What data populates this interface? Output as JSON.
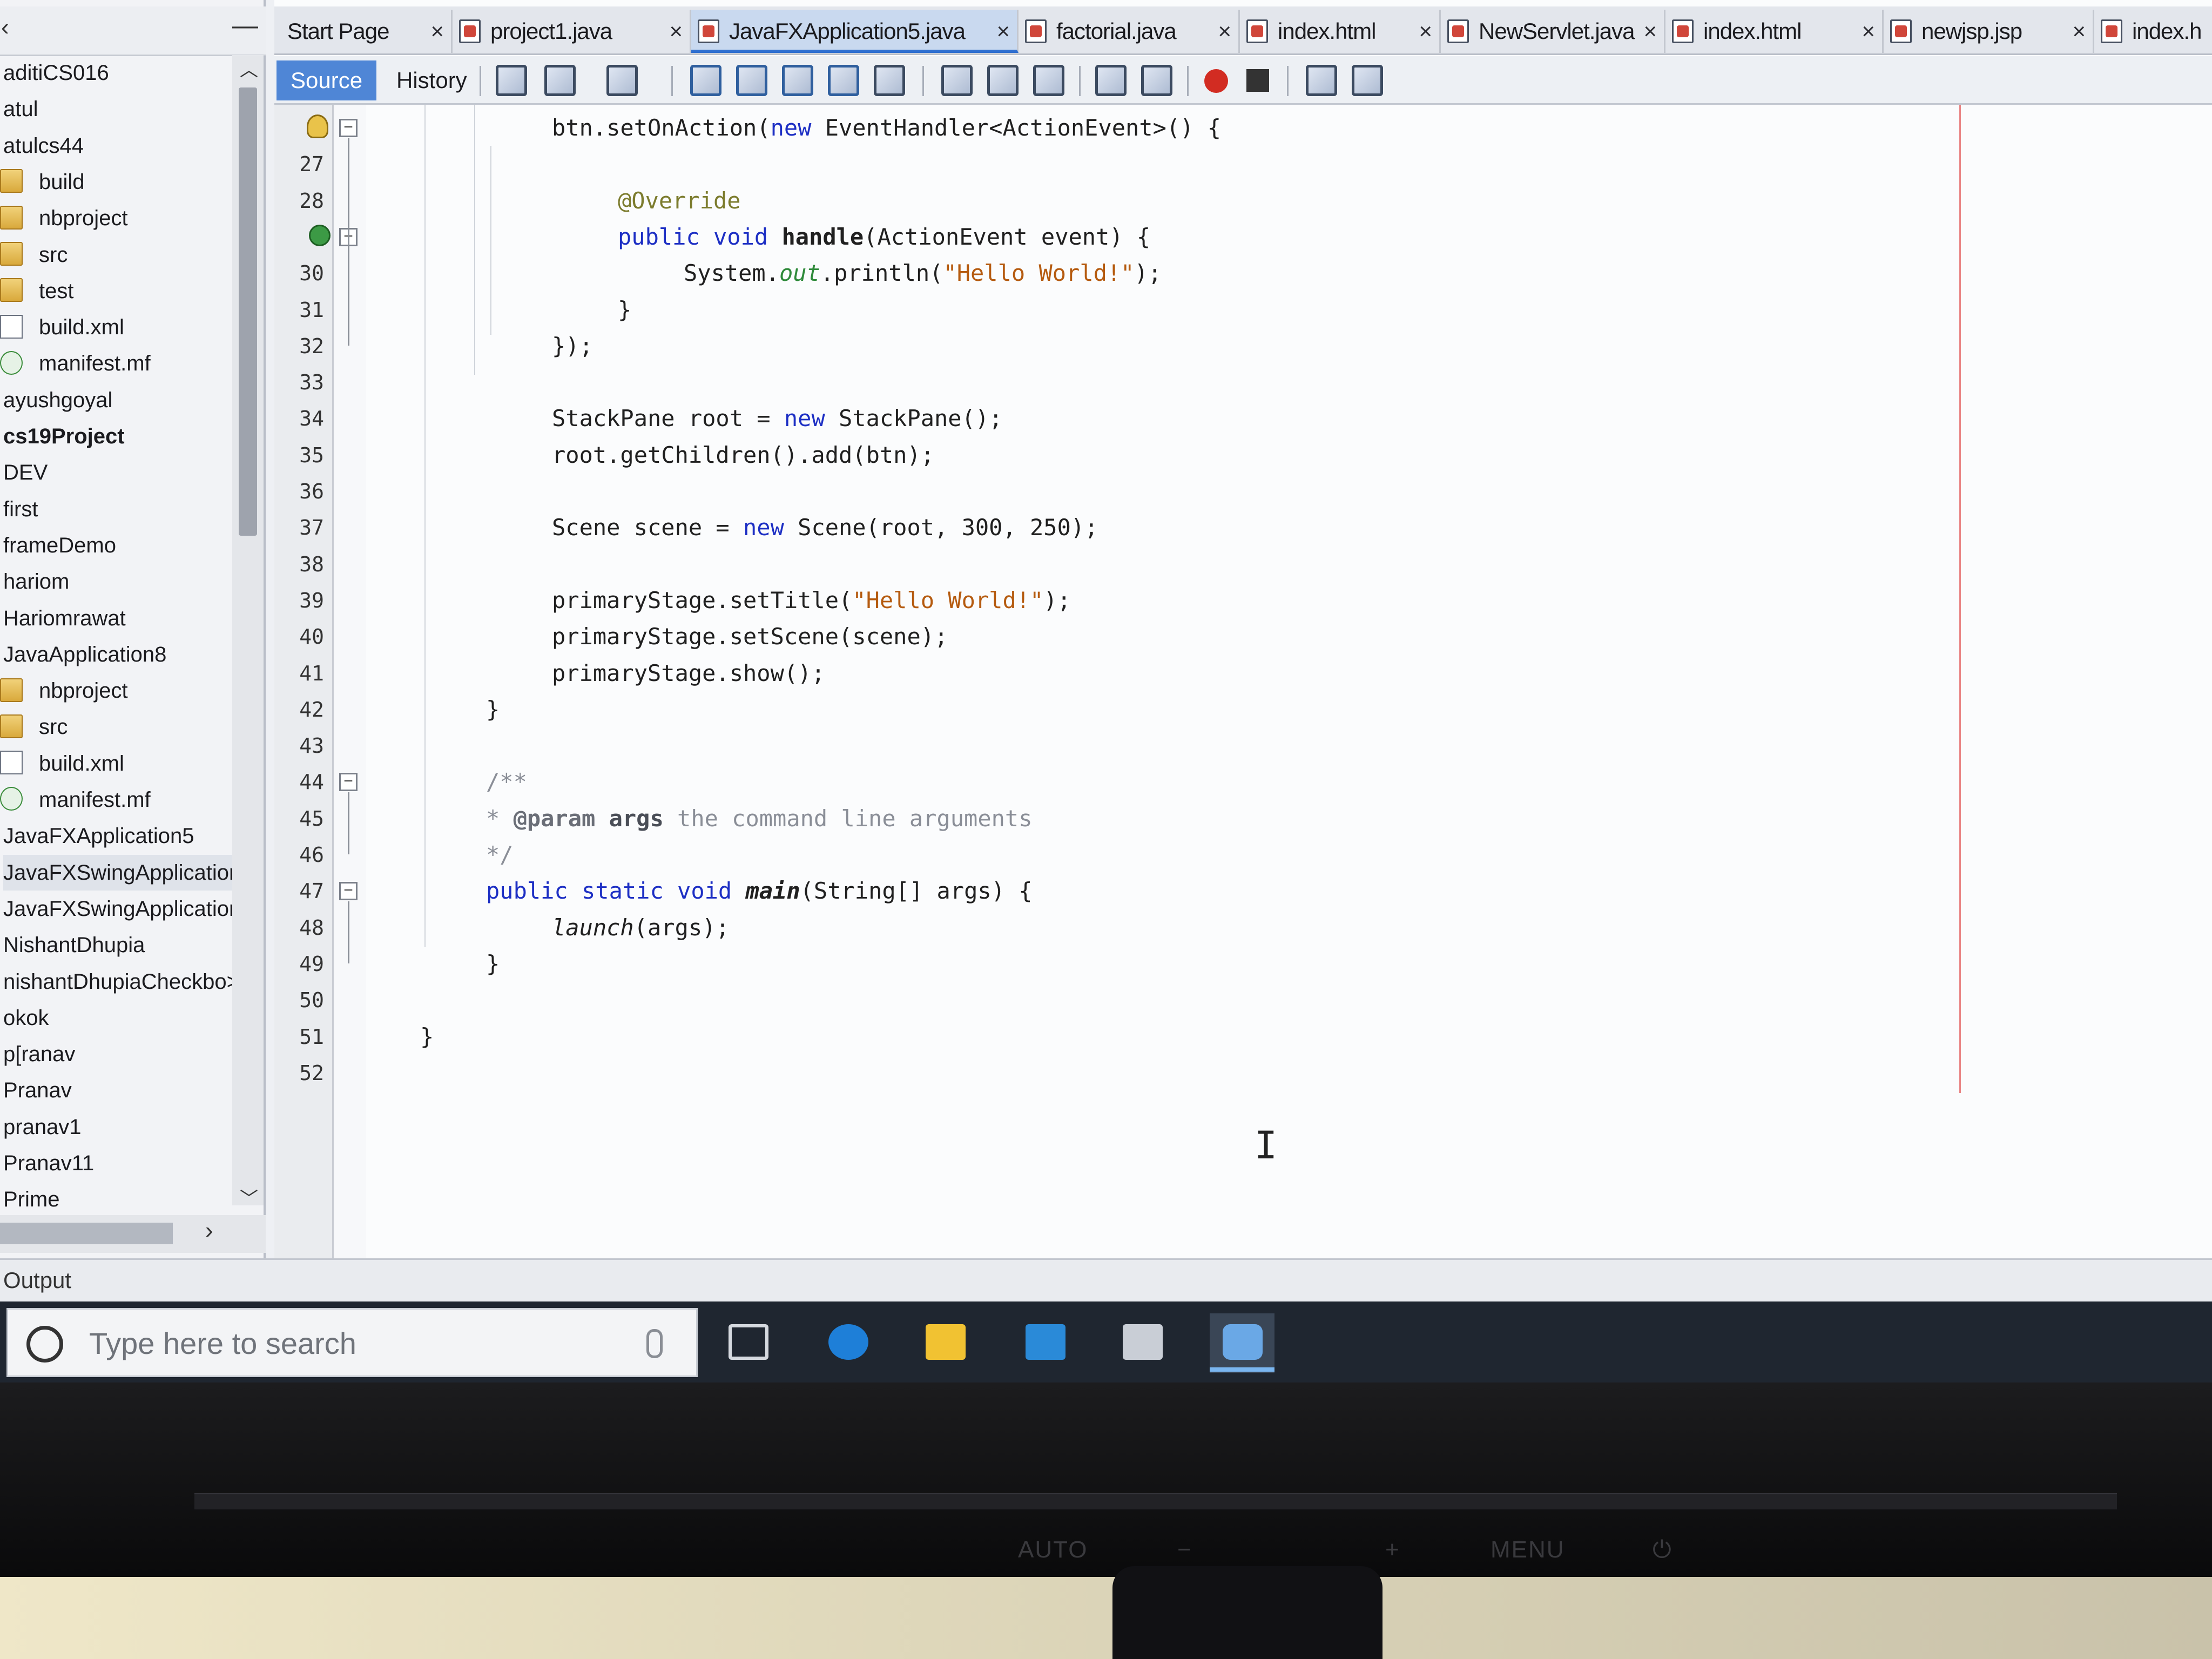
{
  "explorer": {
    "items": [
      {
        "label": "aditiCS016",
        "icon": "none"
      },
      {
        "label": "atul",
        "icon": "none"
      },
      {
        "label": "atulcs44",
        "icon": "none"
      },
      {
        "label": "build",
        "icon": "folder-icon"
      },
      {
        "label": "nbproject",
        "icon": "folder-icon"
      },
      {
        "label": "src",
        "icon": "folder-icon"
      },
      {
        "label": "test",
        "icon": "folder-icon"
      },
      {
        "label": "build.xml",
        "icon": "xml-file-icon"
      },
      {
        "label": "manifest.mf",
        "icon": "manifest-file-icon"
      },
      {
        "label": "ayushgoyal",
        "icon": "none"
      },
      {
        "label": "cs19Project",
        "icon": "none"
      },
      {
        "label": "DEV",
        "icon": "none"
      },
      {
        "label": "first",
        "icon": "none"
      },
      {
        "label": "frameDemo",
        "icon": "none"
      },
      {
        "label": "hariom",
        "icon": "none"
      },
      {
        "label": "Hariomrawat",
        "icon": "none"
      },
      {
        "label": "JavaApplication8",
        "icon": "none"
      },
      {
        "label": "nbproject",
        "icon": "folder-icon"
      },
      {
        "label": "src",
        "icon": "folder-icon"
      },
      {
        "label": "build.xml",
        "icon": "xml-file-icon"
      },
      {
        "label": "manifest.mf",
        "icon": "manifest-file-icon"
      },
      {
        "label": "JavaFXApplication5",
        "icon": "none"
      },
      {
        "label": "JavaFXSwingApplicatior",
        "icon": "none"
      },
      {
        "label": "JavaFXSwingApplicatior",
        "icon": "none"
      },
      {
        "label": "NishantDhupia",
        "icon": "none"
      },
      {
        "label": "nishantDhupiaCheckbo>",
        "icon": "none"
      },
      {
        "label": "okok",
        "icon": "none"
      },
      {
        "label": "p[ranav",
        "icon": "none"
      },
      {
        "label": "Pranav",
        "icon": "none"
      },
      {
        "label": "pranav1",
        "icon": "none"
      },
      {
        "label": "Pranav11",
        "icon": "none"
      },
      {
        "label": "Prime",
        "icon": "none"
      }
    ]
  },
  "tabs": [
    {
      "label": "Start Page",
      "close": "×",
      "active": false
    },
    {
      "label": "project1.java",
      "close": "×",
      "active": false
    },
    {
      "label": "JavaFXApplication5.java",
      "close": "×",
      "active": true
    },
    {
      "label": "factorial.java",
      "close": "×",
      "active": false
    },
    {
      "label": "index.html",
      "close": "×",
      "active": false
    },
    {
      "label": "NewServlet.java",
      "close": "×",
      "active": false
    },
    {
      "label": "index.html",
      "close": "×",
      "active": false
    },
    {
      "label": "newjsp.jsp",
      "close": "×",
      "active": false
    },
    {
      "label": "index.h",
      "close": "",
      "active": false
    }
  ],
  "toolbar": {
    "source_label": "Source",
    "history_label": "History"
  },
  "code": {
    "lines": [
      {
        "num": "",
        "text": "btn.setOnAction(new EventHandler<ActionEvent>() {"
      },
      {
        "num": "27",
        "text": ""
      },
      {
        "num": "28",
        "text": "@Override"
      },
      {
        "num": "",
        "text": "public void handle(ActionEvent event) {"
      },
      {
        "num": "30",
        "text": "System.out.println(\"Hello World!\");"
      },
      {
        "num": "31",
        "text": "}"
      },
      {
        "num": "32",
        "text": "});"
      },
      {
        "num": "33",
        "text": ""
      },
      {
        "num": "34",
        "text": "StackPane root = new StackPane();"
      },
      {
        "num": "35",
        "text": "root.getChildren().add(btn);"
      },
      {
        "num": "36",
        "text": ""
      },
      {
        "num": "37",
        "text": "Scene scene = new Scene(root, 300, 250);"
      },
      {
        "num": "38",
        "text": ""
      },
      {
        "num": "39",
        "text": "primaryStage.setTitle(\"Hello World!\");"
      },
      {
        "num": "40",
        "text": "primaryStage.setScene(scene);"
      },
      {
        "num": "41",
        "text": "primaryStage.show();"
      },
      {
        "num": "42",
        "text": "}"
      },
      {
        "num": "43",
        "text": ""
      },
      {
        "num": "44",
        "text": "/**"
      },
      {
        "num": "45",
        "text": "* @param args the command line arguments"
      },
      {
        "num": "46",
        "text": "*/"
      },
      {
        "num": "47",
        "text": "public static void main(String[] args) {"
      },
      {
        "num": "48",
        "text": "launch(args);"
      },
      {
        "num": "49",
        "text": "}"
      },
      {
        "num": "50",
        "text": ""
      },
      {
        "num": "51",
        "text": "}"
      },
      {
        "num": "52",
        "text": ""
      }
    ]
  },
  "output_label": "Output",
  "taskbar": {
    "search_placeholder": "Type here to search",
    "apps": [
      "task-view-icon",
      "edge-icon",
      "file-explorer-icon",
      "mail-icon",
      "store-icon",
      "netbeans-icon"
    ]
  },
  "monitor": {
    "buttons": [
      "AUTO",
      "−",
      "+",
      "MENU",
      "⏻"
    ]
  }
}
